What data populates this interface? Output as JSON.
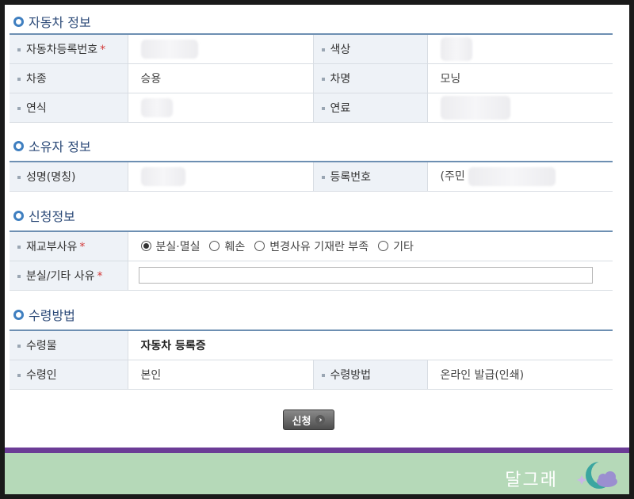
{
  "sections": {
    "vehicle": {
      "title": "자동차 정보",
      "reg_no_label": "자동차등록번호",
      "color_label": "색상",
      "type_label": "차종",
      "type_value": "승용",
      "name_label": "차명",
      "name_value": "모닝",
      "year_label": "연식",
      "fuel_label": "연료"
    },
    "owner": {
      "title": "소유자 정보",
      "name_label": "성명(명칭)",
      "reg_label": "등록번호",
      "reg_prefix": "(주민"
    },
    "application": {
      "title": "신청정보",
      "reason_label": "재교부사유",
      "options": [
        "분실·멸실",
        "훼손",
        "변경사유 기재란 부족",
        "기타"
      ],
      "selected_option": "분실·멸실",
      "other_reason_label": "분실/기타 사유",
      "other_reason_value": ""
    },
    "receipt": {
      "title": "수령방법",
      "item_label": "수령물",
      "item_value": "자동차 등록증",
      "receiver_label": "수령인",
      "receiver_value": "본인",
      "method_label": "수령방법",
      "method_value": "온라인 발급(인쇄)"
    }
  },
  "required_mark": "*",
  "submit_label": "신청",
  "footer": {
    "brand": "달그래"
  },
  "colors": {
    "accent": "#3f7fc0",
    "footer_bar": "#6b3c96",
    "footer_bg": "#b5d9b8"
  }
}
